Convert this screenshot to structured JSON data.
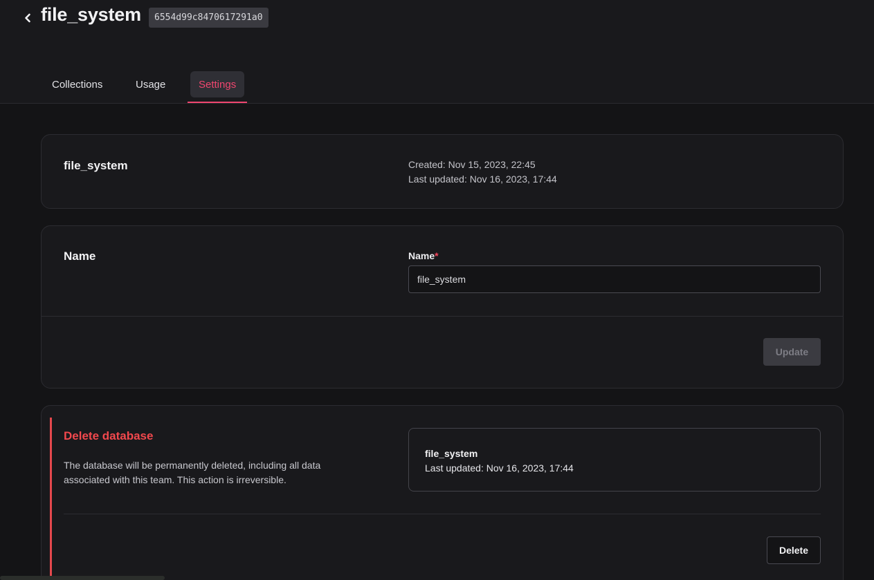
{
  "header": {
    "title": "file_system",
    "database_id": "6554d99c8470617291a0"
  },
  "tabs": [
    {
      "label": "Collections",
      "active": false
    },
    {
      "label": "Usage",
      "active": false
    },
    {
      "label": "Settings",
      "active": true
    }
  ],
  "overview": {
    "title": "file_system",
    "created": "Created: Nov 15, 2023, 22:45",
    "last_updated": "Last updated: Nov 16, 2023, 17:44"
  },
  "name_section": {
    "title": "Name",
    "field_label": "Name",
    "required_marker": "*",
    "value": "file_system",
    "update_label": "Update"
  },
  "delete_section": {
    "title": "Delete database",
    "description": "The database will be permanently deleted, including all data associated with this team. This action is irreversible.",
    "summary_name": "file_system",
    "summary_updated": "Last updated: Nov 16, 2023, 17:44",
    "delete_label": "Delete"
  },
  "colors": {
    "accent": "#f0466f",
    "danger": "#e5484d",
    "background": "#141416",
    "surface": "#19191c"
  },
  "icons": {
    "back": "chevron-left-icon"
  }
}
